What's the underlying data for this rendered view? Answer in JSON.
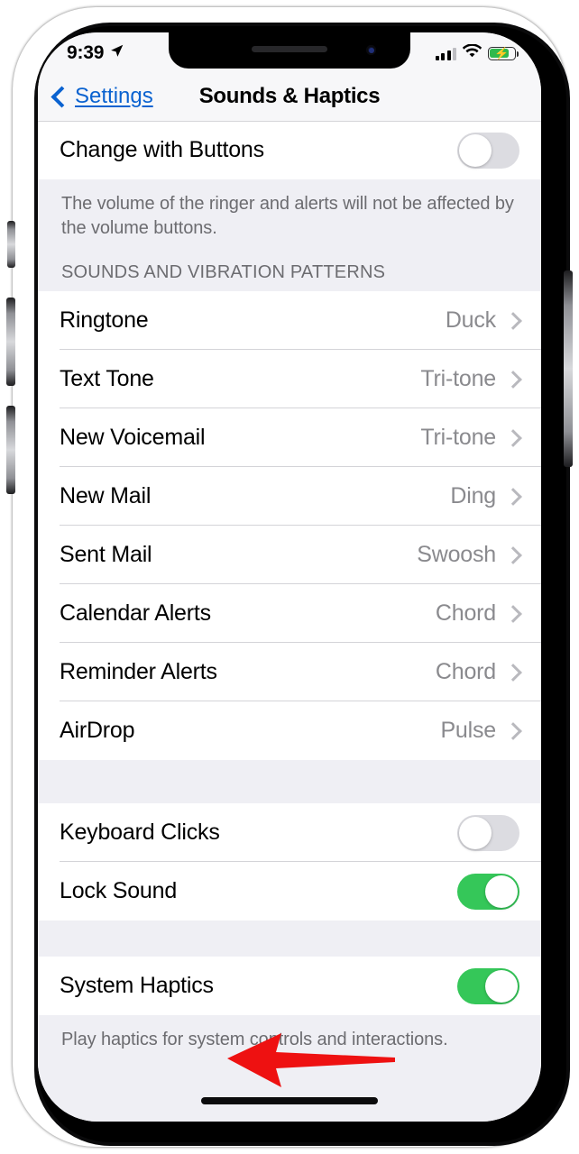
{
  "status_bar": {
    "time": "9:39",
    "location_icon": "location-arrow-icon",
    "signal_icon": "cellular-signal-icon",
    "wifi_icon": "wifi-icon",
    "battery_icon": "battery-charging-icon",
    "battery_charging": true
  },
  "nav": {
    "back_label": "Settings",
    "back_icon": "chevron-left-icon",
    "title": "Sounds & Haptics",
    "accent_color": "#0a62d0"
  },
  "colors": {
    "toggle_on": "#35c759",
    "toggle_off": "#dcdce1",
    "arrow": "#ee1111",
    "group_background": "#efeff4",
    "row_background": "#ffffff",
    "secondary_text": "#8a8a8e"
  },
  "annotation": {
    "arrow_icon": "red-left-arrow-icon",
    "points_to": "System Haptics",
    "color": "#ee1111"
  },
  "sections": [
    {
      "rows": [
        {
          "label": "Change with Buttons",
          "type": "toggle",
          "value": "off"
        }
      ],
      "footer": "The volume of the ringer and alerts will not be affected by the volume buttons."
    },
    {
      "header": "SOUNDS AND VIBRATION PATTERNS",
      "rows": [
        {
          "label": "Ringtone",
          "type": "disclosure",
          "value": "Duck"
        },
        {
          "label": "Text Tone",
          "type": "disclosure",
          "value": "Tri-tone"
        },
        {
          "label": "New Voicemail",
          "type": "disclosure",
          "value": "Tri-tone"
        },
        {
          "label": "New Mail",
          "type": "disclosure",
          "value": "Ding"
        },
        {
          "label": "Sent Mail",
          "type": "disclosure",
          "value": "Swoosh"
        },
        {
          "label": "Calendar Alerts",
          "type": "disclosure",
          "value": "Chord"
        },
        {
          "label": "Reminder Alerts",
          "type": "disclosure",
          "value": "Chord"
        },
        {
          "label": "AirDrop",
          "type": "disclosure",
          "value": "Pulse"
        }
      ]
    },
    {
      "rows": [
        {
          "label": "Keyboard Clicks",
          "type": "toggle",
          "value": "off"
        },
        {
          "label": "Lock Sound",
          "type": "toggle",
          "value": "on"
        }
      ]
    },
    {
      "rows": [
        {
          "label": "System Haptics",
          "type": "toggle",
          "value": "on"
        }
      ],
      "footer": "Play haptics for system controls and interactions."
    }
  ]
}
